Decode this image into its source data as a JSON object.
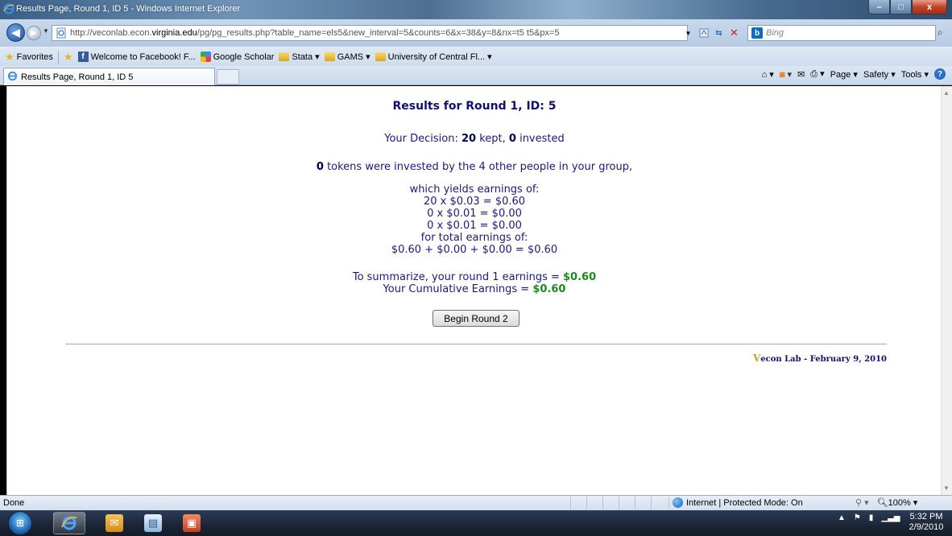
{
  "window": {
    "title": "Results Page, Round 1, ID 5 - Windows Internet Explorer",
    "min_glyph": "–",
    "max_glyph": "□",
    "close_glyph": "x"
  },
  "address": {
    "url_prefix": "http://veconlab.econ.",
    "url_domain": "virginia.edu",
    "url_rest": "/pg/pg_results.php?table_name=els5&new_interval=5&counts=6&x=38&y=8&nx=t5 t5&px=5",
    "search_placeholder": "Bing"
  },
  "favorites": {
    "favorites_label": "Favorites",
    "items": [
      {
        "label": "Welcome to Facebook! F...",
        "icon": "facebook-icon"
      },
      {
        "label": "Google Scholar",
        "icon": "google-scholar-icon"
      },
      {
        "label": "Stata ▾",
        "icon": "folder-icon"
      },
      {
        "label": "GAMS ▾",
        "icon": "folder-icon"
      },
      {
        "label": "University of Central Fl... ▾",
        "icon": "folder-icon"
      }
    ]
  },
  "tabs": {
    "active_label": "Results Page, Round 1, ID 5"
  },
  "commandbar": {
    "page": "Page ▾",
    "safety": "Safety ▾",
    "tools": "Tools ▾",
    "help": "?"
  },
  "results": {
    "heading": "Results for Round 1, ID: 5",
    "decision_prefix": "Your Decision: ",
    "kept_value": "20",
    "kept_label": " kept, ",
    "invested_value": "0",
    "invested_label": " invested",
    "group_value": "0",
    "group_text": " tokens were invested by the 4 other people in your group,",
    "calc_lines": [
      "which yields earnings of:",
      "20 x $0.03 = $0.60",
      "0 x $0.01 = $0.00",
      "0 x $0.01 = $0.00",
      "for total earnings of:",
      "$0.60 + $0.00 + $0.00 = $0.60"
    ],
    "summary_prefix": "To summarize, your round 1 earnings = ",
    "summary_value": "$0.60",
    "cumulative_prefix": "Your Cumulative Earnings = ",
    "cumulative_value": "$0.60",
    "next_button": "Begin Round 2",
    "footer_v": "V",
    "footer_text": "econ Lab - February 9, 2010"
  },
  "status": {
    "left": "Done",
    "zone": "Internet | Protected Mode: On",
    "zoom": "100%"
  },
  "taskbar": {
    "time": "5:32 PM",
    "date": "2/9/2010"
  },
  "colors": {
    "heading": "#101070",
    "text": "#1a1a7a",
    "earnings": "#1e8a1e",
    "footer_v": "#d4a017"
  }
}
